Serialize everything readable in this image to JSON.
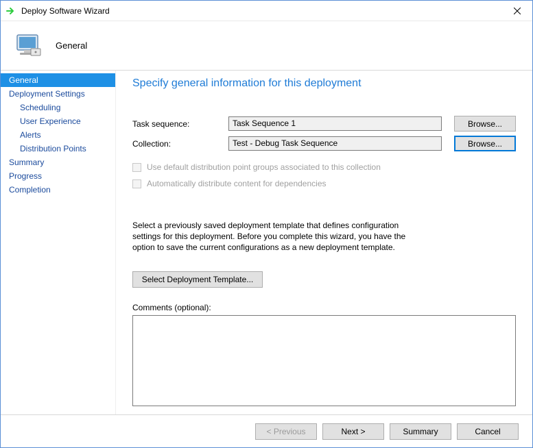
{
  "window": {
    "title": "Deploy Software Wizard"
  },
  "header": {
    "title": "General"
  },
  "sidebar": {
    "items": [
      {
        "label": "General",
        "selected": true,
        "sub": false
      },
      {
        "label": "Deployment Settings",
        "selected": false,
        "sub": false
      },
      {
        "label": "Scheduling",
        "selected": false,
        "sub": true
      },
      {
        "label": "User Experience",
        "selected": false,
        "sub": true
      },
      {
        "label": "Alerts",
        "selected": false,
        "sub": true
      },
      {
        "label": "Distribution Points",
        "selected": false,
        "sub": true
      },
      {
        "label": "Summary",
        "selected": false,
        "sub": false
      },
      {
        "label": "Progress",
        "selected": false,
        "sub": false
      },
      {
        "label": "Completion",
        "selected": false,
        "sub": false
      }
    ]
  },
  "main": {
    "heading": "Specify general information for this deployment",
    "task_sequence_label": "Task sequence:",
    "task_sequence_value": "Task Sequence 1",
    "collection_label": "Collection:",
    "collection_value": "Test - Debug Task Sequence",
    "browse_label": "Browse...",
    "chk_default_dp": "Use default distribution point groups associated to this collection",
    "chk_auto_distribute": "Automatically distribute content for dependencies",
    "help_text": "Select a previously saved deployment template that defines configuration settings for this deployment. Before you complete this wizard, you have the option to save the current configurations as a new deployment template.",
    "select_template_label": "Select Deployment Template...",
    "comments_label": "Comments (optional):",
    "comments_value": ""
  },
  "footer": {
    "previous": "< Previous",
    "next": "Next >",
    "summary": "Summary",
    "cancel": "Cancel"
  }
}
